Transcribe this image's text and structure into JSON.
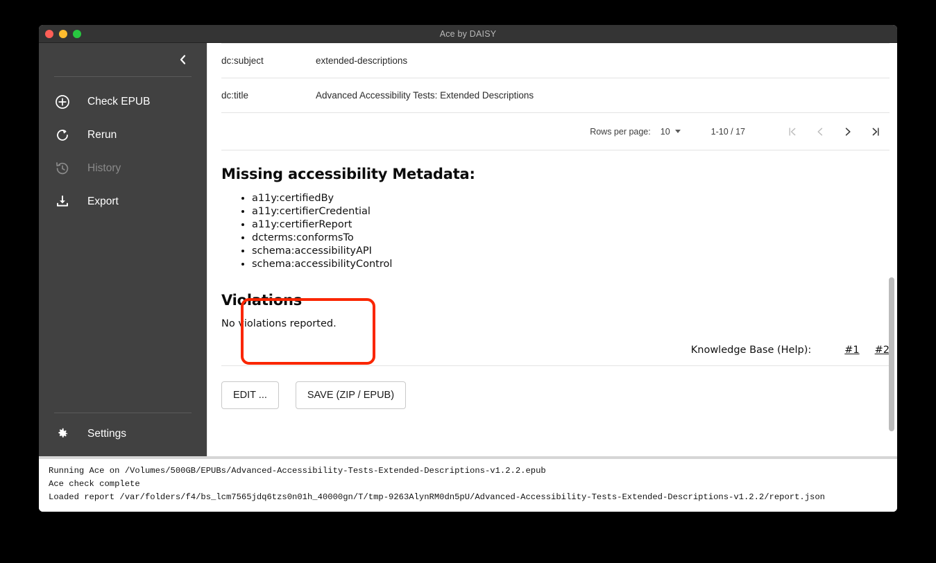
{
  "window": {
    "title": "Ace by DAISY",
    "traffic_lights": [
      "close-button",
      "minimize-button",
      "maximize-button"
    ]
  },
  "sidebar": {
    "collapse_icon": "chevron-left-icon",
    "items": [
      {
        "label": "Check EPUB",
        "icon": "plus-circle-icon",
        "enabled": true
      },
      {
        "label": "Rerun",
        "icon": "refresh-icon",
        "enabled": true
      },
      {
        "label": "History",
        "icon": "history-clock-icon",
        "enabled": false
      },
      {
        "label": "Export",
        "icon": "download-icon",
        "enabled": true
      }
    ],
    "settings": {
      "label": "Settings",
      "icon": "gear-icon"
    }
  },
  "metadata_table": {
    "columns": [
      "key",
      "value"
    ],
    "rows": [
      {
        "key": "dc:subject",
        "value": "extended-descriptions"
      },
      {
        "key": "dc:title",
        "value": "Advanced Accessibility Tests: Extended Descriptions"
      }
    ]
  },
  "paginator": {
    "rows_per_page_label": "Rows per page:",
    "rows_per_page_value": "10",
    "range_label": "1-10 / 17",
    "first_icon": "first-page-icon",
    "prev_icon": "previous-page-icon",
    "next_icon": "next-page-icon",
    "last_icon": "last-page-icon"
  },
  "report": {
    "missing_heading": "Missing accessibility Metadata:",
    "missing_items": [
      "a11y:certifiedBy",
      "a11y:certifierCredential",
      "a11y:certifierReport",
      "dcterms:conformsTo",
      "schema:accessibilityAPI",
      "schema:accessibilityControl"
    ],
    "violations_heading": "Violations",
    "violations_text": "No violations reported.",
    "knowledge_base_label": "Knowledge Base (Help):",
    "knowledge_base_links": [
      "#1",
      "#2"
    ]
  },
  "actions": {
    "edit_label": "EDIT ...",
    "save_label": "SAVE (ZIP / EPUB)"
  },
  "console": {
    "lines": [
      "Running Ace on /Volumes/500GB/EPUBs/Advanced-Accessibility-Tests-Extended-Descriptions-v1.2.2.epub",
      "Ace check complete",
      "Loaded report /var/folders/f4/bs_lcm7565jdq6tzs0n01h_40000gn/T/tmp-9263AlynRM0dn5pU/Advanced-Accessibility-Tests-Extended-Descriptions-v1.2.2/report.json"
    ]
  },
  "annotation": {
    "shape": "rounded-rectangle-highlight",
    "color": "#fa2600"
  }
}
